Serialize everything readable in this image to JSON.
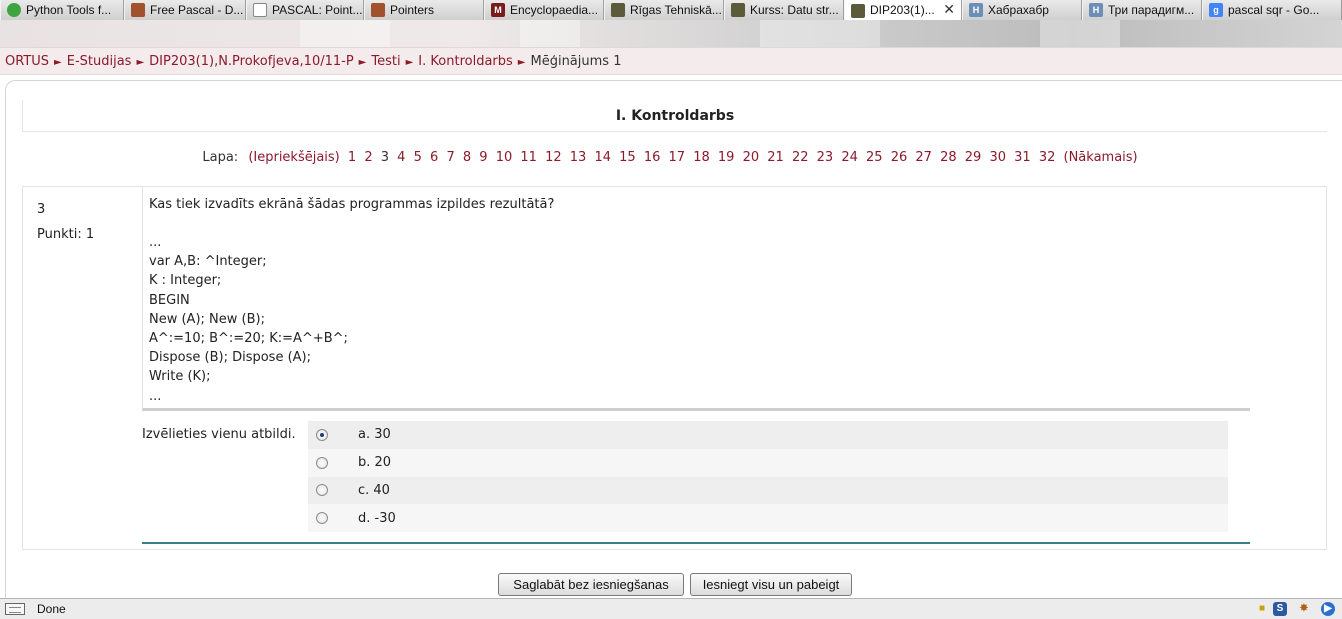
{
  "browser": {
    "tabs": [
      {
        "label": "Python Tools f...",
        "icon": "python-tools-icon",
        "color": "#3fa33f",
        "glyph": ""
      },
      {
        "label": "Free Pascal - D...",
        "icon": "free-pascal-icon",
        "color": "#a0522d",
        "glyph": ""
      },
      {
        "label": "PASCAL: Point...",
        "icon": "document-icon",
        "color": "#ffffff",
        "glyph": ""
      },
      {
        "label": "Pointers",
        "icon": "free-pascal-icon",
        "color": "#a0522d",
        "glyph": ""
      },
      {
        "label": "Encyclopaedia...",
        "icon": "encyclopaedia-icon",
        "color": "#7a1a1a",
        "glyph": "M"
      },
      {
        "label": "Rīgas Tehniskā...",
        "icon": "rtu-shield-icon",
        "color": "#5b5b3a",
        "glyph": ""
      },
      {
        "label": "Kurss: Datu str...",
        "icon": "rtu-shield-icon",
        "color": "#5b5b3a",
        "glyph": ""
      },
      {
        "label": "DIP203(1)...",
        "icon": "rtu-shield-icon",
        "color": "#5b5b3a",
        "glyph": "",
        "active": true
      },
      {
        "label": "Хабрахабр",
        "icon": "habr-icon",
        "color": "#6d8fb5",
        "glyph": "H"
      },
      {
        "label": "Три парадигм...",
        "icon": "habr-icon",
        "color": "#6d8fb5",
        "glyph": "H"
      },
      {
        "label": "pascal sqr - Go...",
        "icon": "google-icon",
        "color": "#4285f4",
        "glyph": "g"
      }
    ],
    "status_text": "Done"
  },
  "breadcrumb": {
    "items": [
      "ORTUS",
      "E-Studijas",
      "DIP203(1),N.Prokofjeva,10/11-P",
      "Testi",
      "I. Kontroldarbs"
    ],
    "current": "Mēģinājums 1",
    "separator": "►"
  },
  "quiz": {
    "title": "I. Kontroldarbs",
    "pager": {
      "label": "Lapa:",
      "prev": "(Iepriekšējais)",
      "next": "(Nākamais)",
      "pages": [
        "1",
        "2",
        "3",
        "4",
        "5",
        "6",
        "7",
        "8",
        "9",
        "10",
        "11",
        "12",
        "13",
        "14",
        "15",
        "16",
        "17",
        "18",
        "19",
        "20",
        "21",
        "22",
        "23",
        "24",
        "25",
        "26",
        "27",
        "28",
        "29",
        "30",
        "31",
        "32"
      ],
      "current_page": "3"
    },
    "question": {
      "number": "3",
      "points": "Punkti: 1",
      "text": "Kas tiek izvadīts ekrānā šādas programmas izpildes rezultātā?",
      "code_lines": [
        "...",
        "var A,B: ^Integer;",
        "K : Integer;",
        "BEGIN",
        "New (A); New (B);",
        "A^:=10; B^:=20; K:=A^+B^;",
        "Dispose (B); Dispose (A);",
        "Write (K);",
        "..."
      ],
      "answer_prompt": "Izvēlieties vienu atbildi.",
      "answers": [
        {
          "label": "a. 30",
          "checked": true
        },
        {
          "label": "b. 20",
          "checked": false
        },
        {
          "label": "c. 40",
          "checked": false
        },
        {
          "label": "d. -30",
          "checked": false
        }
      ]
    },
    "buttons": {
      "save": "Saglabāt bez iesniegšanas",
      "submit": "Iesniegt visu un pabeigt"
    }
  },
  "colors": {
    "link": "#8b1a2b",
    "accent_line": "#3f7b84",
    "breadcrumb_bg": "#f4ecec"
  }
}
